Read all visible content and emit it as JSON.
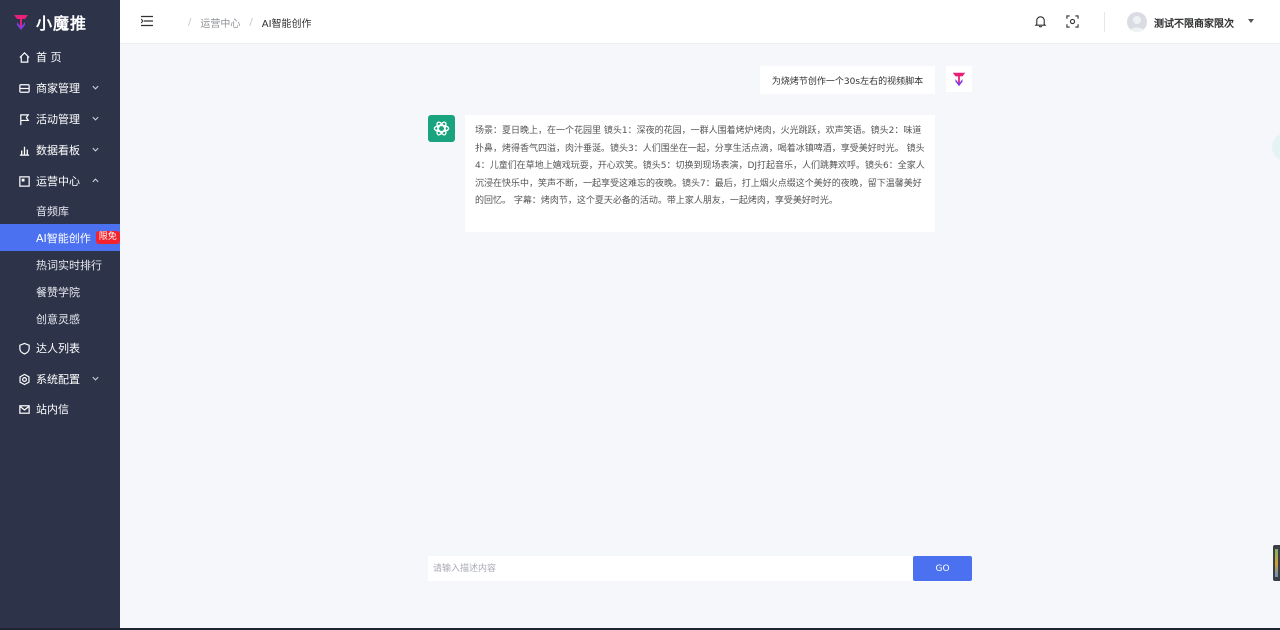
{
  "app": {
    "name": "小魔推"
  },
  "sidebar": {
    "items": [
      {
        "label": "首 页",
        "icon": "home-icon"
      },
      {
        "label": "商家管理",
        "icon": "shop-icon"
      },
      {
        "label": "活动管理",
        "icon": "flag-icon"
      },
      {
        "label": "数据看板",
        "icon": "chart-icon"
      },
      {
        "label": "运营中心",
        "icon": "operation-icon"
      },
      {
        "label": "达人列表",
        "icon": "shield-icon"
      },
      {
        "label": "系统配置",
        "icon": "settings-icon"
      },
      {
        "label": "站内信",
        "icon": "mail-icon"
      }
    ],
    "submenu": [
      {
        "label": "音频库"
      },
      {
        "label": "AI智能创作",
        "badge": "限免"
      },
      {
        "label": "热词实时排行"
      },
      {
        "label": "餐赞学院"
      },
      {
        "label": "创意灵感"
      }
    ],
    "accent_color": "#4c71f0"
  },
  "header": {
    "breadcrumb": [
      "运营中心",
      "AI智能创作"
    ],
    "user": {
      "name": "测试不限商家限次"
    }
  },
  "chat": {
    "user_message": "为烧烤节创作一个30s左右的视频脚本",
    "bot_message": "场景：夏日晚上，在一个花园里 镜头1：深夜的花园，一群人围着烤炉烤肉，火光跳跃，欢声笑语。镜头2：味道扑鼻，烤得香气四溢，肉汁垂涎。镜头3：人们围坐在一起，分享生活点滴，喝着冰镇啤酒，享受美好时光。 镜头4：儿童们在草地上嬉戏玩耍，开心欢笑。镜头5：切换到现场表演，DJ打起音乐，人们跳舞欢呼。镜头6：全家人沉浸在快乐中，笑声不断，一起享受这难忘的夜晚。镜头7：最后，打上烟火点缀这个美好的夜晚，留下温馨美好的回忆。 字幕：烤肉节，这个夏天必备的活动。带上家人朋友，一起烤肉，享受美好时光。",
    "input_placeholder": "请输入描述内容",
    "go_label": "GO"
  }
}
